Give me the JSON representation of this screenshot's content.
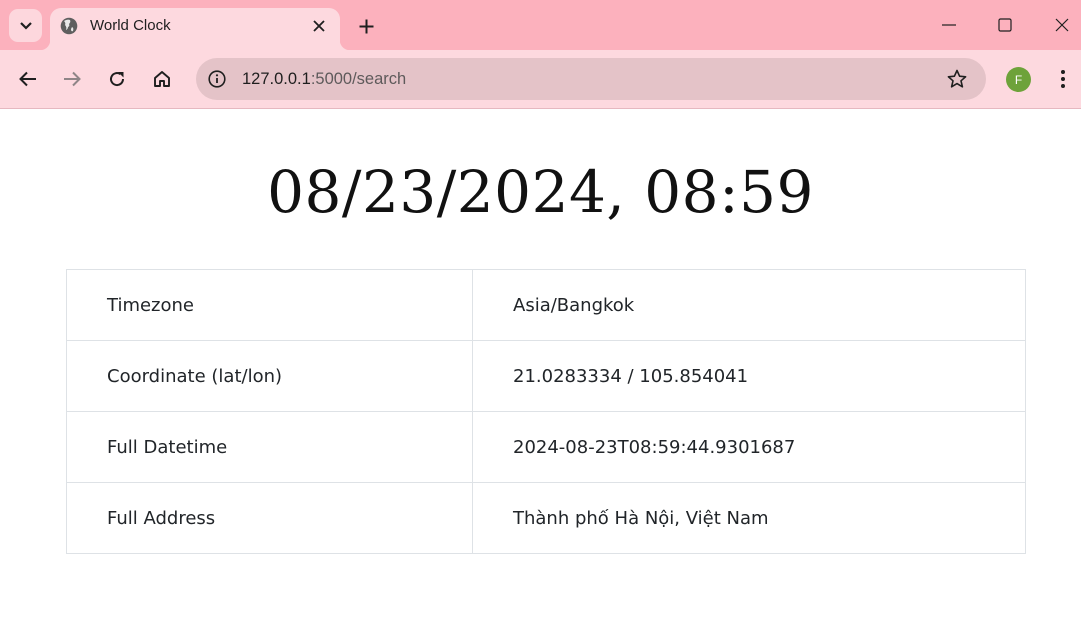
{
  "browser": {
    "tab_title": "World Clock",
    "url_host": "127.0.0.1",
    "url_rest": ":5000/search",
    "profile_initial": "F",
    "icons": [
      "tab-search-icon",
      "globe-icon",
      "close-icon",
      "plus-icon",
      "minimize-icon",
      "maximize-icon",
      "window-close-icon",
      "back-arrow-icon",
      "forward-arrow-icon",
      "reload-icon",
      "home-icon",
      "site-info-icon",
      "star-icon",
      "more-vert-icon"
    ],
    "colors": {
      "titlebar": "#fcb1bd",
      "toolbar": "#fdd9df",
      "omnibox": "#e4c3c8",
      "avatar": "#6ea23a"
    }
  },
  "page": {
    "datetime": "08/23/2024, 08:59",
    "rows": [
      {
        "label": "Timezone",
        "value": "Asia/Bangkok"
      },
      {
        "label": "Coordinate (lat/lon)",
        "value": "21.0283334 / 105.854041"
      },
      {
        "label": "Full Datetime",
        "value": "2024-08-23T08:59:44.9301687"
      },
      {
        "label": "Full Address",
        "value": "Thành phố Hà Nội, Việt Nam"
      }
    ]
  }
}
